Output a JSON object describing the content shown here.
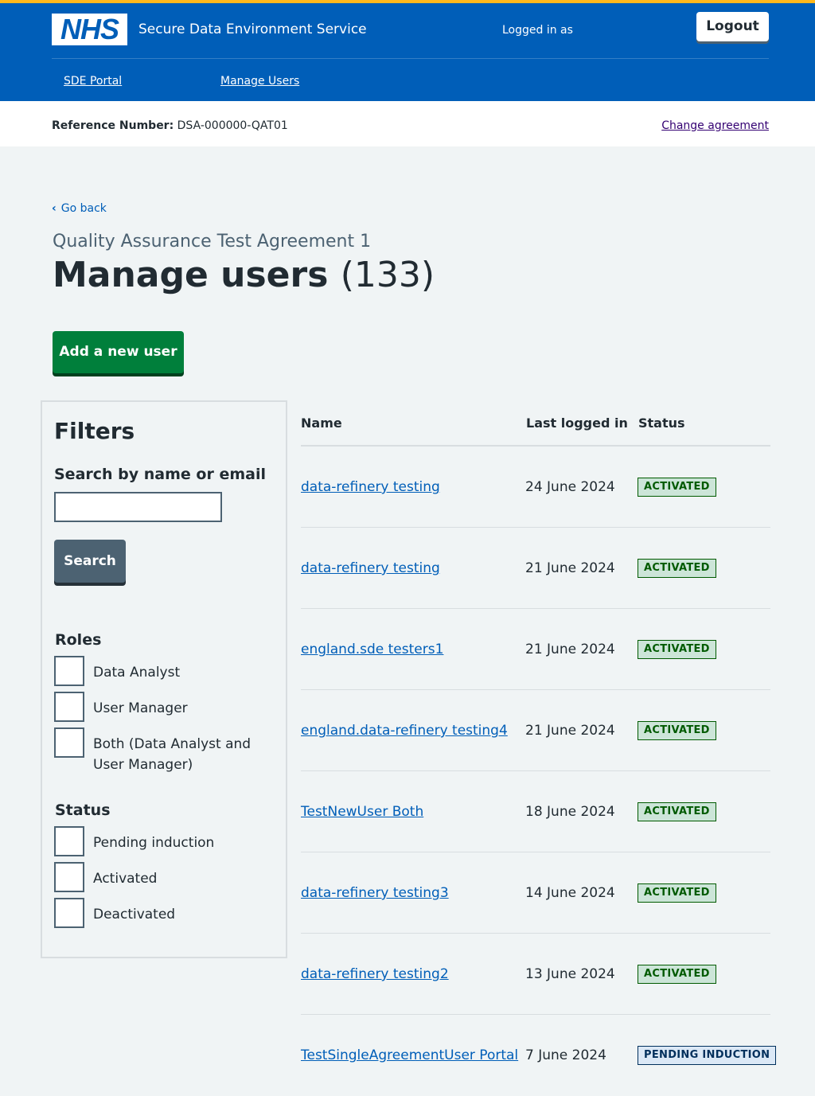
{
  "header": {
    "logo_text": "NHS",
    "service_name": "Secure Data Environment Service",
    "logged_in_label": "Logged in as",
    "logout_label": "Logout",
    "nav": [
      {
        "label": "SDE Portal"
      },
      {
        "label": "Manage Users"
      }
    ]
  },
  "reference": {
    "label": "Reference Number:",
    "value": "DSA-000000-QAT01",
    "change_label": "Change agreement"
  },
  "page": {
    "back_label": "Go back",
    "caption": "Quality Assurance Test Agreement 1",
    "title": "Manage users",
    "count": "(133)",
    "add_user_label": "Add a new user"
  },
  "filters": {
    "title": "Filters",
    "search_label": "Search by name or email",
    "search_value": "",
    "search_button": "Search",
    "roles_title": "Roles",
    "roles": [
      "Data Analyst",
      "User Manager",
      "Both (Data Analyst and User Manager)"
    ],
    "status_title": "Status",
    "statuses": [
      "Pending induction",
      "Activated",
      "Deactivated"
    ]
  },
  "table": {
    "headers": [
      "Name",
      "Last logged in",
      "Status"
    ],
    "rows": [
      {
        "name": "data-refinery testing",
        "last_logged_in": "24 June 2024",
        "status": "ACTIVATED"
      },
      {
        "name": "data-refinery testing",
        "last_logged_in": "21 June 2024",
        "status": "ACTIVATED"
      },
      {
        "name": "england.sde testers1",
        "last_logged_in": "21 June 2024",
        "status": "ACTIVATED"
      },
      {
        "name": "england.data-refinery testing4",
        "last_logged_in": "21 June 2024",
        "status": "ACTIVATED"
      },
      {
        "name": "TestNewUser Both",
        "last_logged_in": "18 June 2024",
        "status": "ACTIVATED"
      },
      {
        "name": "data-refinery testing3",
        "last_logged_in": "14 June 2024",
        "status": "ACTIVATED"
      },
      {
        "name": "data-refinery testing2",
        "last_logged_in": "13 June 2024",
        "status": "ACTIVATED"
      },
      {
        "name": "TestSingleAgreementUser Portal",
        "last_logged_in": "7 June 2024",
        "status": "PENDING INDUCTION"
      }
    ]
  },
  "colors": {
    "header_blue": "#005eb8",
    "activated_tag": "#005a00",
    "pending_tag": "#002f5c",
    "primary_button": "#007f3b"
  }
}
